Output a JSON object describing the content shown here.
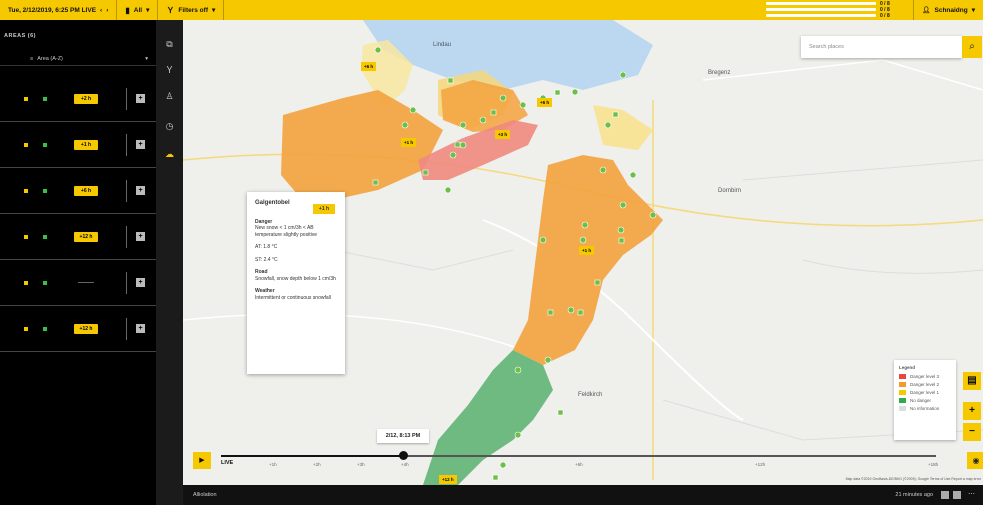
{
  "topbar": {
    "datetime": "Tue, 2/12/2019, 6:25 PM LIVE",
    "nav_prev": "‹",
    "nav_next": "›",
    "scope_label": "All",
    "filter_label": "Filters off",
    "stats": [
      "0 / 8",
      "0 / 8",
      "0 / 8"
    ],
    "user_label": "Schnaidng"
  },
  "left_panel": {
    "header": "AREAS (6)",
    "filter_label": "Area (A-Z)",
    "rows": [
      {
        "badge": "+2 h"
      },
      {
        "badge": "+1 h"
      },
      {
        "badge": "+6 h"
      },
      {
        "badge": "+12 h"
      },
      {
        "badge": ""
      },
      {
        "badge": "+12 h"
      }
    ]
  },
  "rail": [
    "layers-icon",
    "filter-icon",
    "person-icon",
    "history-icon",
    "weather-icon"
  ],
  "map": {
    "search_placeholder": "Search places",
    "places": [
      {
        "name": "Bregenz"
      },
      {
        "name": "Dornbirn"
      },
      {
        "name": "Feldkirch"
      },
      {
        "name": "Lindau"
      }
    ],
    "labels": [
      "+6 h",
      "+6 h",
      "+3 h",
      "+1 h",
      "+1 h",
      "+12 h"
    ],
    "popup": {
      "title": "Galgentobel",
      "badge": "+1 h",
      "danger_title": "Danger",
      "danger_text": "New snow < 1 cm/3h < AB temperature slightly positive",
      "at": "AT: 1.8 °C",
      "st": "ST: 2.4 °C",
      "road_title": "Road",
      "road_text": "Snowfall, snow depth below 1 cm/3h",
      "weather_title": "Weather",
      "weather_text": "Intermittent or continuous snowfall"
    },
    "legend": {
      "title": "Legend",
      "items": [
        {
          "label": "Danger level 3",
          "color": "#e8473d"
        },
        {
          "label": "Danger level 2",
          "color": "#f39a2a"
        },
        {
          "label": "Danger level 1",
          "color": "#f5c800"
        },
        {
          "label": "No danger",
          "color": "#33a853"
        },
        {
          "label": "No information",
          "color": "#dddddd"
        }
      ]
    },
    "attribution": "Map data ©2019 GeoBasis-DE/BKG (©2009), Google    Terms of Use    Report a map error"
  },
  "timeline": {
    "tooltip": "2/12, 8:13 PM",
    "ticks": [
      "LIVE",
      "+1h",
      "+2h",
      "+3h",
      "+4h",
      "+6h",
      "+12h",
      "+18h",
      "+24h"
    ]
  },
  "bottombar": {
    "left": "Alliolation",
    "right": "21 minutes ago"
  },
  "colors": {
    "accent": "#f5c800",
    "danger3": "#e8473d",
    "danger2": "#f39a2a",
    "green": "#33a853"
  }
}
